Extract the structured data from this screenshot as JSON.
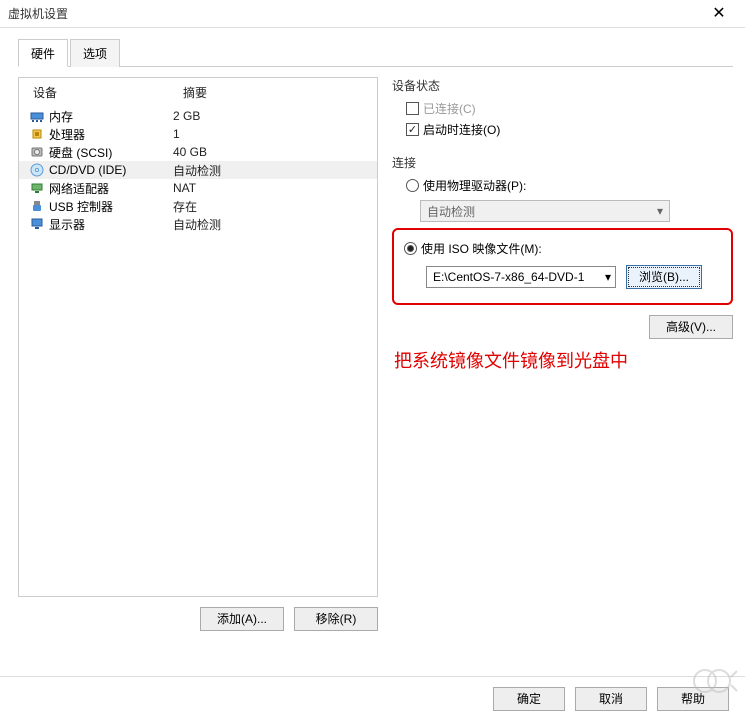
{
  "window": {
    "title": "虚拟机设置"
  },
  "tabs": {
    "hardware": "硬件",
    "options": "选项"
  },
  "device_table": {
    "head_device": "设备",
    "head_summary": "摘要",
    "rows": [
      {
        "icon": "memory-icon",
        "name": "内存",
        "summary": "2 GB"
      },
      {
        "icon": "cpu-icon",
        "name": "处理器",
        "summary": "1"
      },
      {
        "icon": "disk-icon",
        "name": "硬盘 (SCSI)",
        "summary": "40 GB"
      },
      {
        "icon": "cd-icon",
        "name": "CD/DVD (IDE)",
        "summary": "自动检测"
      },
      {
        "icon": "net-icon",
        "name": "网络适配器",
        "summary": "NAT"
      },
      {
        "icon": "usb-icon",
        "name": "USB 控制器",
        "summary": "存在"
      },
      {
        "icon": "display-icon",
        "name": "显示器",
        "summary": "自动检测"
      }
    ]
  },
  "buttons": {
    "add": "添加(A)...",
    "remove": "移除(R)"
  },
  "status": {
    "title": "设备状态",
    "connected": "已连接(C)",
    "connect_on_power": "启动时连接(O)"
  },
  "connection": {
    "title": "连接",
    "use_physical": "使用物理驱动器(P):",
    "physical_value": "自动检测",
    "use_iso": "使用 ISO 映像文件(M):",
    "iso_path": "E:\\CentOS-7-x86_64-DVD-1",
    "browse": "浏览(B)...",
    "advanced": "高级(V)..."
  },
  "annotation": "把系统镜像文件镜像到光盘中",
  "footer": {
    "ok": "确定",
    "cancel": "取消",
    "help": "帮助"
  }
}
